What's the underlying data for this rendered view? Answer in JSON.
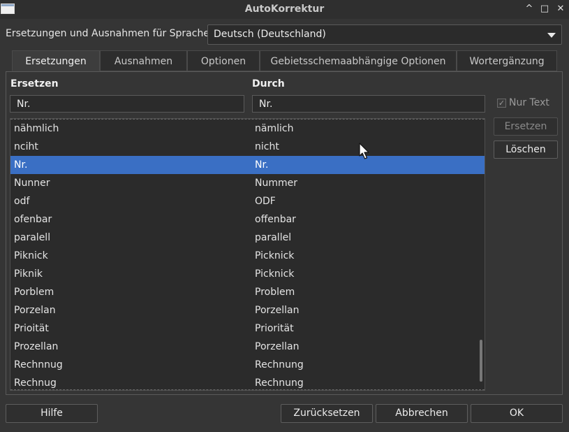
{
  "window": {
    "title": "AutoKorrektur",
    "controls": {
      "minimize": "^",
      "maximize": "□",
      "close": "✕"
    }
  },
  "language": {
    "label": "Ersetzungen und Ausnahmen für Sprache:",
    "value": "Deutsch (Deutschland)"
  },
  "tabs": [
    {
      "label": "Ersetzungen",
      "active": true
    },
    {
      "label": "Ausnahmen"
    },
    {
      "label": "Optionen"
    },
    {
      "label": "Gebietsschemaabhängige Optionen"
    },
    {
      "label": "Wortergänzung"
    }
  ],
  "replace": {
    "header": "Ersetzen",
    "value": "Nr."
  },
  "with": {
    "header": "Durch",
    "value": "Nr."
  },
  "plain_text": {
    "label": "Nur Text",
    "checked": true,
    "disabled": true
  },
  "buttons": {
    "replace": "Ersetzen",
    "delete": "Löschen",
    "help": "Hilfe",
    "reset": "Zurücksetzen",
    "cancel": "Abbrechen",
    "ok": "OK"
  },
  "list": {
    "selected": "Nr.",
    "rows": [
      [
        "nähmlich",
        "nämlich"
      ],
      [
        "nciht",
        "nicht"
      ],
      [
        "Nr.",
        "Nr."
      ],
      [
        "Nunner",
        "Nummer"
      ],
      [
        "odf",
        "ODF"
      ],
      [
        "ofenbar",
        "offenbar"
      ],
      [
        "paralell",
        "parallel"
      ],
      [
        "Piknick",
        "Picknick"
      ],
      [
        "Piknik",
        "Picknick"
      ],
      [
        "Porblem",
        "Problem"
      ],
      [
        "Porzelan",
        "Porzellan"
      ],
      [
        "Prioität",
        "Priorität"
      ],
      [
        "Prozellan",
        "Porzellan"
      ],
      [
        "Rechnnug",
        "Rechnung"
      ],
      [
        "Rechnug",
        "Rechnung"
      ]
    ]
  },
  "colors": {
    "selection": "#3a6fc4",
    "background": "#353535"
  }
}
